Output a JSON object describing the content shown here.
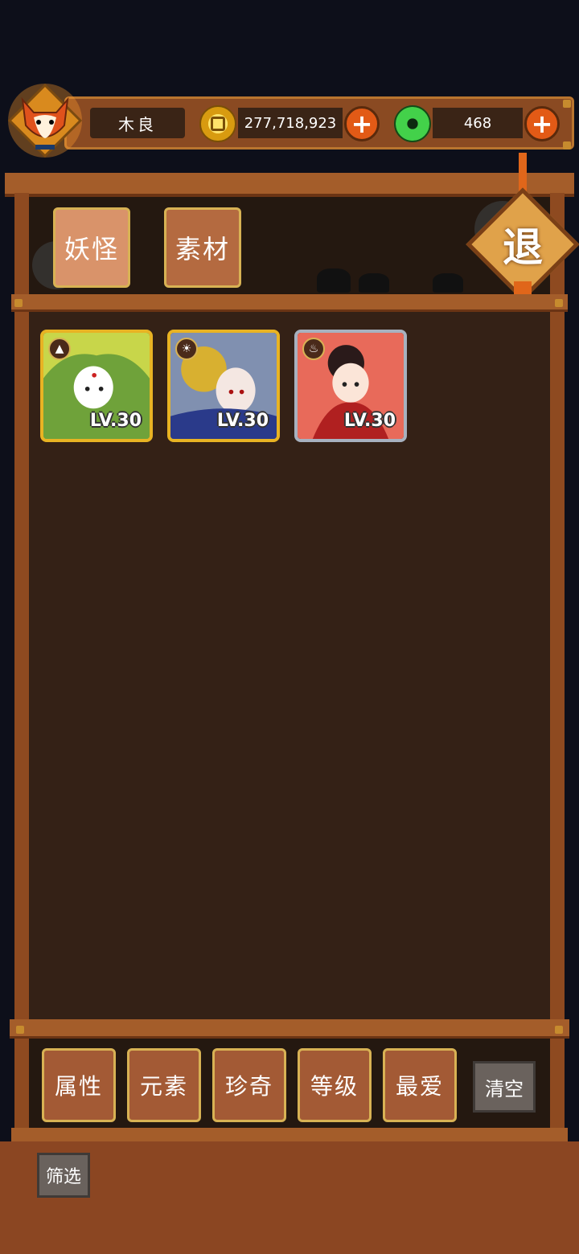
{
  "player": {
    "name": "木良",
    "gold": "277,718,923",
    "jade": "468"
  },
  "icons": {
    "avatar": "fox-mask-icon",
    "gold": "gold-coin-icon",
    "jade": "jade-disc-icon",
    "add": "plus-icon"
  },
  "tabs": [
    {
      "label": "妖怪",
      "active": true
    },
    {
      "label": "素材",
      "active": false
    }
  ],
  "exit_label": "退",
  "cards": [
    {
      "level": "LV.30",
      "frame": "gold",
      "element": "earth",
      "colors": [
        "#c8d64a",
        "#6fa23a"
      ]
    },
    {
      "level": "LV.30",
      "frame": "gold",
      "element": "light",
      "colors": [
        "#8090b0",
        "#d8b030"
      ]
    },
    {
      "level": "LV.30",
      "frame": "silver",
      "element": "fire",
      "colors": [
        "#e86a5a",
        "#b02020"
      ]
    }
  ],
  "filters": [
    "属性",
    "元素",
    "珍奇",
    "等级",
    "最爱"
  ],
  "clear_label": "清空",
  "screen_label": "筛选"
}
